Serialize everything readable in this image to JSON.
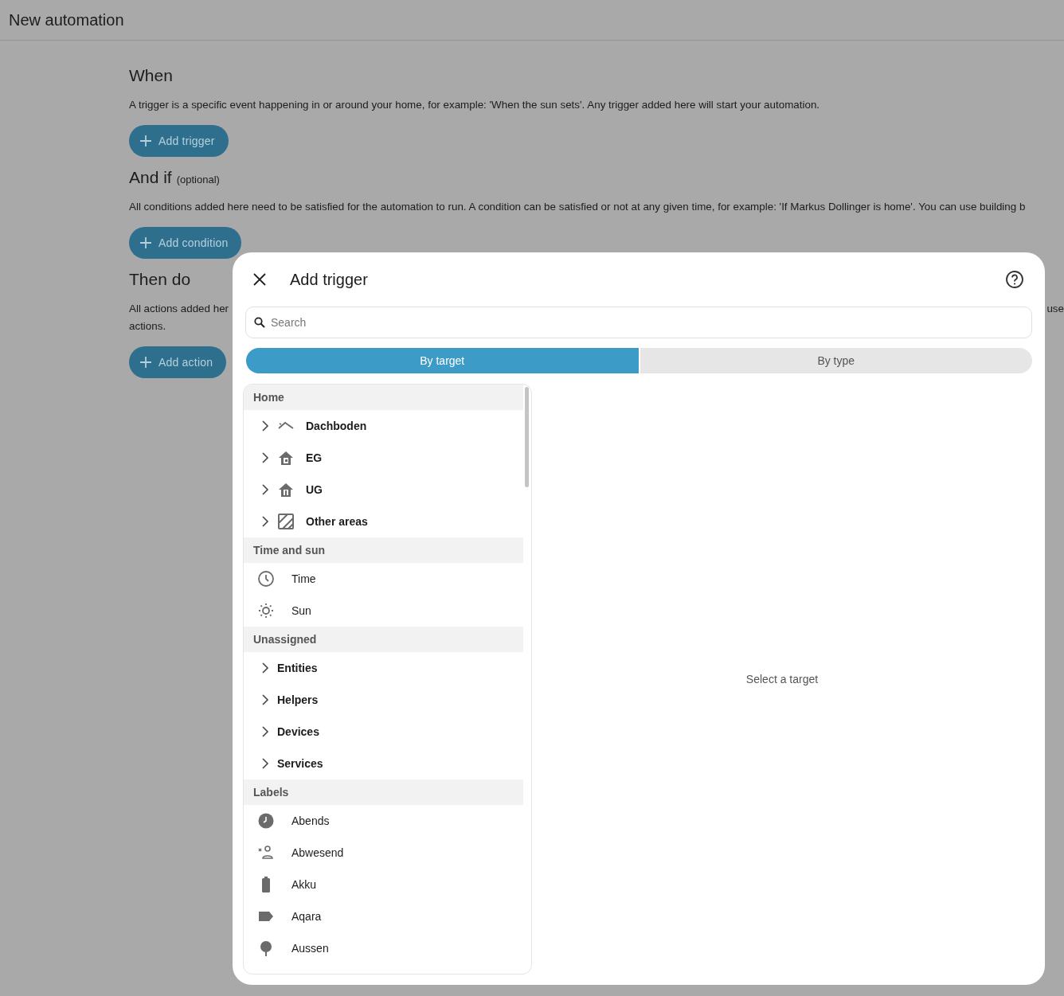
{
  "page": {
    "title": "New automation"
  },
  "sections": [
    {
      "title": "When",
      "lines": [
        [
          "A trigger is a specific event happening in or around your home, for example: 'When the sun sets'. Any trigger added here will start your automation."
        ]
      ],
      "button": "Add trigger"
    },
    {
      "title": "And if",
      "suffix": "(optional)",
      "lines": [
        [
          "All conditions added here need to be satisfied for the automation to run. A condition can be satisfied or not at any given time, for example: 'If Markus Dollinger is home'. You can use building b"
        ]
      ],
      "button": "Add condition"
    },
    {
      "title": "Then do",
      "lines": [
        [
          "All actions added her",
          "use"
        ],
        [
          "actions."
        ]
      ],
      "button": "Add action"
    }
  ],
  "dialog": {
    "title": "Add trigger",
    "search": {
      "placeholder": "Search"
    },
    "tabs": [
      {
        "label": "By target",
        "selected": true
      },
      {
        "label": "By type",
        "selected": false
      }
    ],
    "groups": [
      {
        "title": "Home",
        "items": [
          {
            "kind": "area",
            "label": "Dachboden",
            "expanded": false
          },
          {
            "kind": "area",
            "label": "EG",
            "expanded": false
          },
          {
            "kind": "area",
            "label": "UG",
            "expanded": false
          },
          {
            "kind": "area",
            "label": "Other areas",
            "expanded": false
          }
        ]
      },
      {
        "title": "Time and sun",
        "items": [
          {
            "kind": "entry",
            "label": "Time"
          },
          {
            "kind": "entry",
            "label": "Sun"
          }
        ]
      },
      {
        "title": "Unassigned",
        "items": [
          {
            "kind": "category",
            "label": "Entities",
            "expanded": false
          },
          {
            "kind": "category",
            "label": "Helpers",
            "expanded": false
          },
          {
            "kind": "category",
            "label": "Devices",
            "expanded": false
          },
          {
            "kind": "category",
            "label": "Services",
            "expanded": false
          }
        ]
      },
      {
        "title": "Labels",
        "items": [
          {
            "kind": "entry",
            "label": "Abends"
          },
          {
            "kind": "entry",
            "label": "Abwesend"
          },
          {
            "kind": "entry",
            "label": "Akku"
          },
          {
            "kind": "entry",
            "label": "Aqara"
          },
          {
            "kind": "entry",
            "label": "Aussen"
          }
        ]
      }
    ],
    "empty_state": "Select a target"
  }
}
